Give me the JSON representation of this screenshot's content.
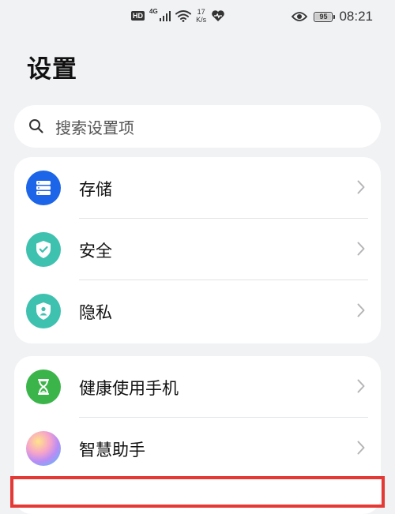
{
  "status_bar": {
    "hd": "HD",
    "network": "4G",
    "speed_value": "17",
    "speed_unit": "K/s",
    "battery": "95",
    "time": "08:21",
    "icons": [
      "hd-icon",
      "signal-icon",
      "wifi-icon",
      "heart-icon",
      "eye-icon",
      "battery-icon"
    ]
  },
  "page": {
    "title": "设置"
  },
  "search": {
    "placeholder": "搜索设置项"
  },
  "groups": [
    {
      "items": [
        {
          "label": "存储",
          "icon": "storage-icon",
          "color": "#1c64e8"
        },
        {
          "label": "安全",
          "icon": "security-shield-icon",
          "color": "#3fc1b0"
        },
        {
          "label": "隐私",
          "icon": "privacy-icon",
          "color": "#3fc1b0"
        }
      ]
    },
    {
      "items": [
        {
          "label": "健康使用手机",
          "icon": "hourglass-icon",
          "color": "#3bb54a"
        },
        {
          "label": "智慧助手",
          "icon": "smart-assistant-icon",
          "color": "#c58df0"
        }
      ]
    }
  ],
  "highlight_color": "#e53935"
}
